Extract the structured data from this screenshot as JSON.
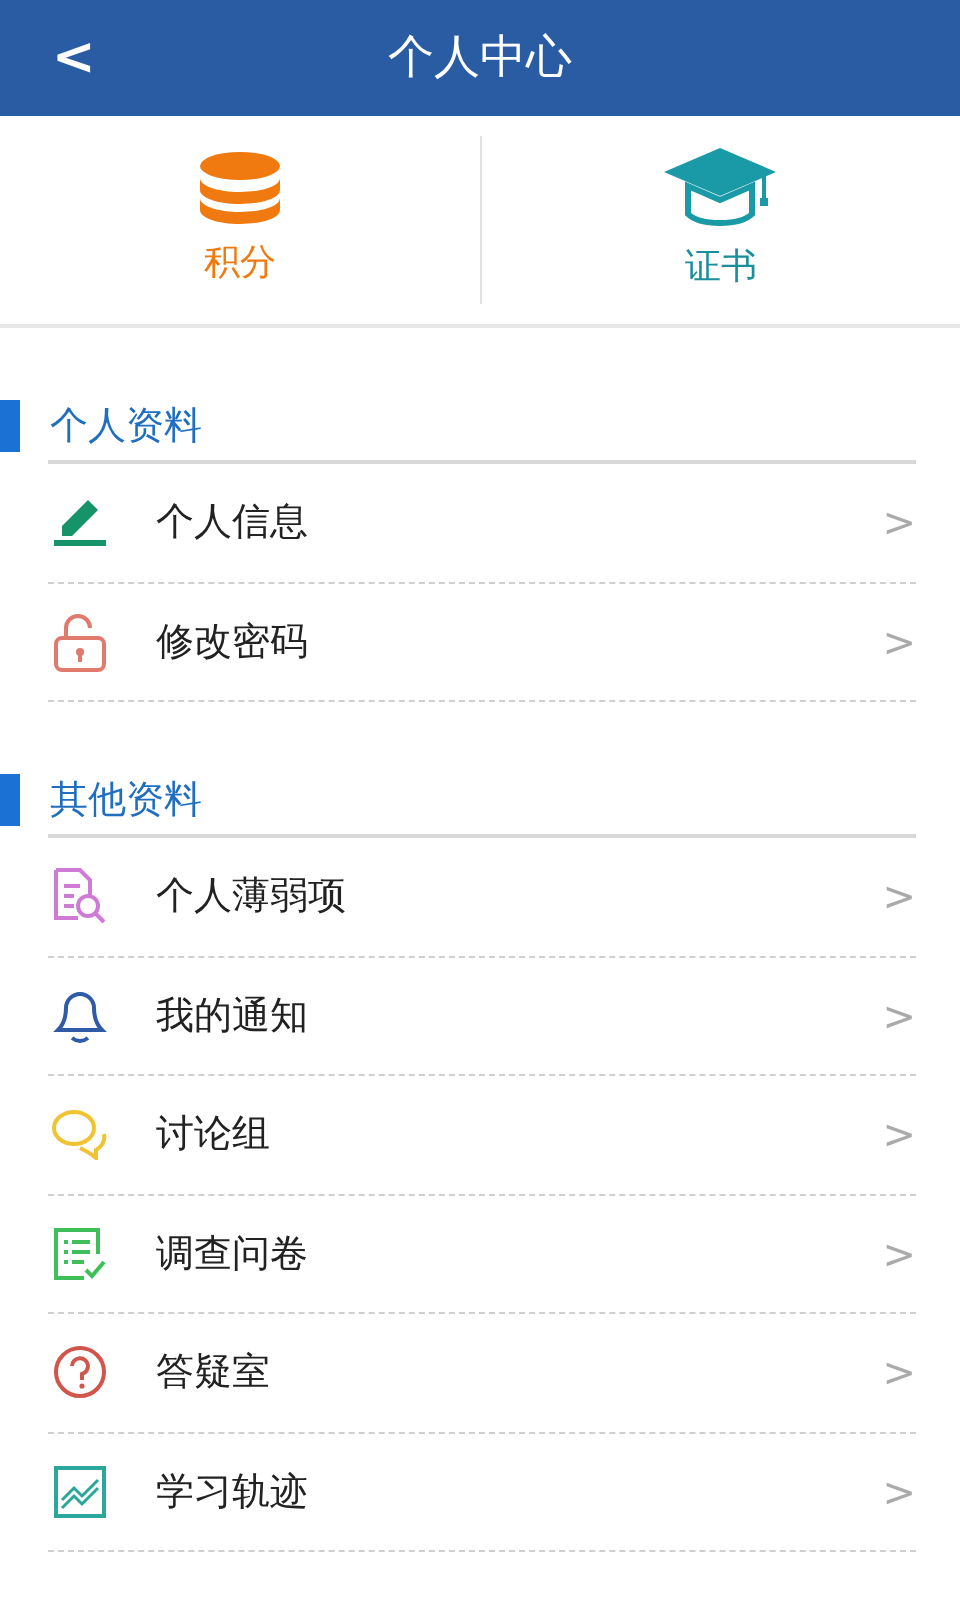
{
  "header": {
    "back": "<",
    "title": "个人中心"
  },
  "shortcuts": [
    {
      "kind": "coins",
      "label": "积分"
    },
    {
      "kind": "cap",
      "label": "证书"
    }
  ],
  "sections": [
    {
      "title": "个人资料",
      "items": [
        {
          "kind": "pencil",
          "label": "个人信息",
          "chevron": ">"
        },
        {
          "kind": "lock",
          "label": "修改密码",
          "chevron": ">"
        }
      ]
    },
    {
      "title": "其他资料",
      "items": [
        {
          "kind": "docsearch",
          "label": "个人薄弱项",
          "chevron": ">"
        },
        {
          "kind": "bell",
          "label": "我的通知",
          "chevron": ">"
        },
        {
          "kind": "chat",
          "label": "讨论组",
          "chevron": ">"
        },
        {
          "kind": "checklist",
          "label": "调查问卷",
          "chevron": ">"
        },
        {
          "kind": "question",
          "label": "答疑室",
          "chevron": ">"
        },
        {
          "kind": "chart",
          "label": "学习轨迹",
          "chevron": ">"
        }
      ]
    }
  ]
}
